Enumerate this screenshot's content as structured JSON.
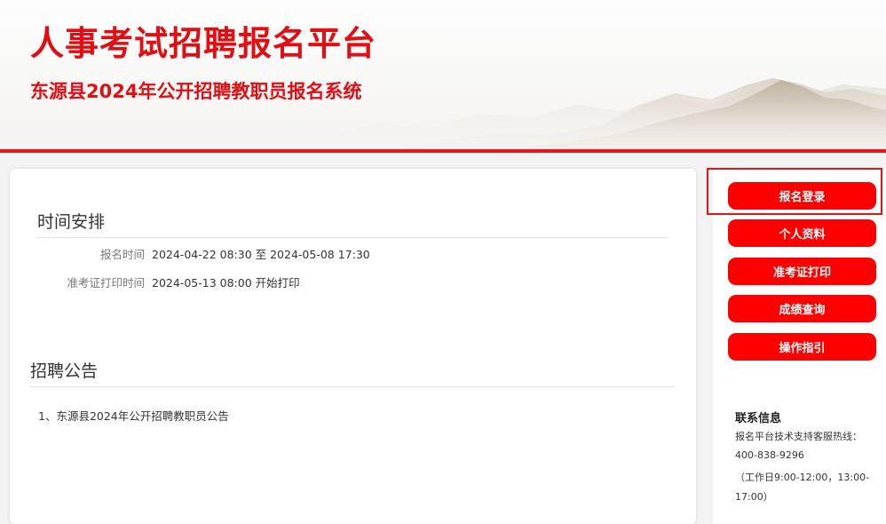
{
  "header": {
    "title": "人事考试招聘报名平台",
    "subtitle": "东源县2024年公开招聘教职员报名系统"
  },
  "schedule": {
    "title": "时间安排",
    "rows": [
      {
        "label": "报名时间",
        "value": "2024-04-22 08:30 至 2024-05-08 17:30"
      },
      {
        "label": "准考证打印时间",
        "value": "2024-05-13 08:00 开始打印"
      }
    ]
  },
  "notices": {
    "title": "招聘公告",
    "items": [
      {
        "text": "1、东源县2024年公开招聘教职员公告"
      }
    ]
  },
  "sidebar": {
    "buttons": [
      {
        "label": "报名登录"
      },
      {
        "label": "个人资料"
      },
      {
        "label": "准考证打印"
      },
      {
        "label": "成绩查询"
      },
      {
        "label": "操作指引"
      }
    ],
    "contact": {
      "title": "联系信息",
      "lines": [
        "报名平台技术支持客服热线：",
        "400-838-9296",
        "（工作日9:00-12:00，13:00-",
        "17:00）"
      ]
    }
  },
  "colors": {
    "brand_red": "#e10f14",
    "button_red": "#ff0000"
  }
}
